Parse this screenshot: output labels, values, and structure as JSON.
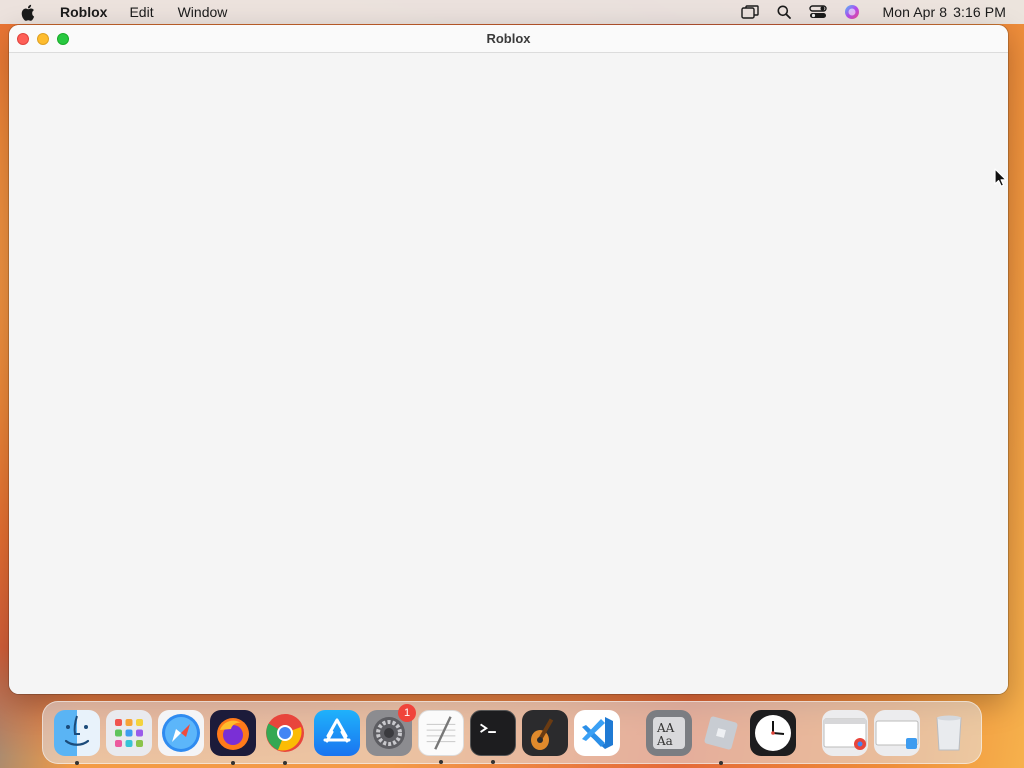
{
  "menubar": {
    "app_name": "Roblox",
    "items": [
      "Edit",
      "Window"
    ],
    "date": "Mon Apr 8",
    "time": "3:16 PM"
  },
  "window": {
    "title": "Roblox"
  },
  "dock": {
    "apps": [
      "Finder",
      "Launchpad",
      "Safari",
      "Firefox",
      "Chrome",
      "App Store",
      "System Settings",
      "TextEdit",
      "Terminal",
      "GarageBand",
      "Visual Studio Code"
    ],
    "settings_badge": "1"
  },
  "colors": {
    "close": "#fe5f57",
    "minimize": "#febc2e",
    "maximize": "#28c840",
    "badge": "#f0443b"
  }
}
